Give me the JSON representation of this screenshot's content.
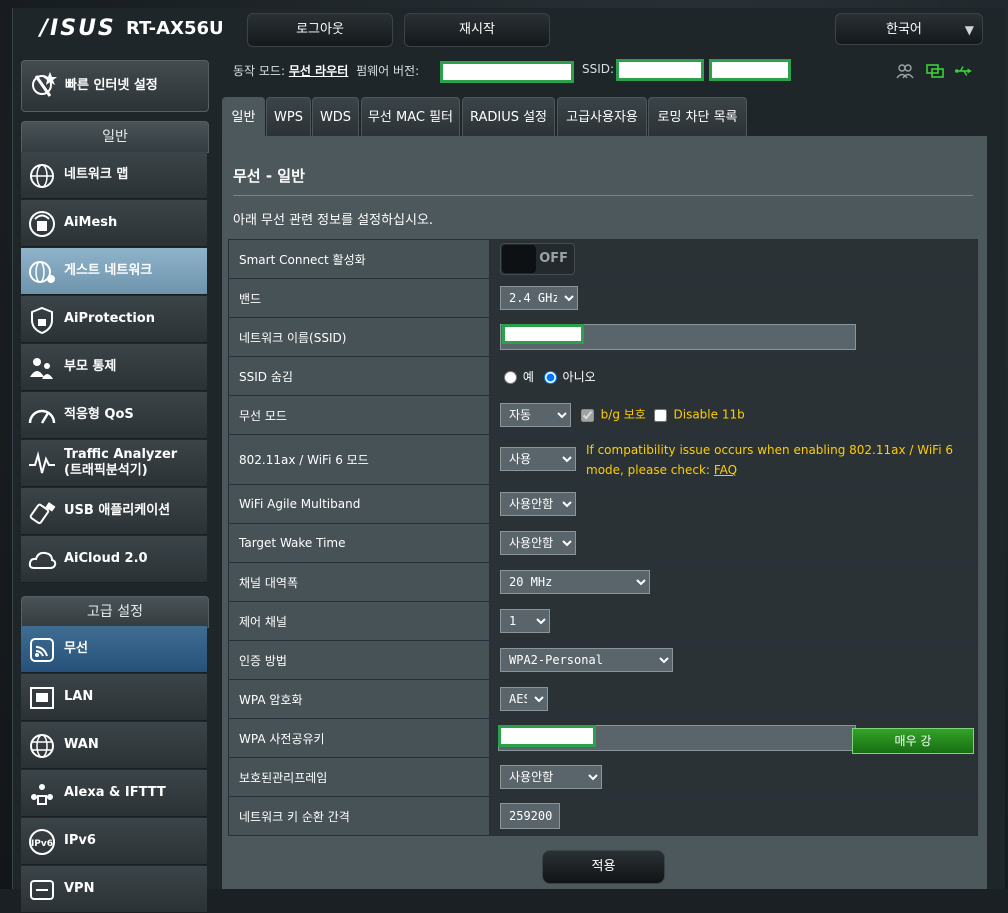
{
  "header": {
    "logo": "/ISUS",
    "model": "RT-AX56U",
    "logout_label": "로그아웃",
    "reboot_label": "재시작",
    "language": "한국어"
  },
  "sidebar": {
    "quick_setup": "빠른 인터넷 설정",
    "general_header": "일반",
    "general_items": [
      {
        "label": "네트워크 맵",
        "icon": "globe-network-icon"
      },
      {
        "label": "AiMesh",
        "icon": "aimesh-icon"
      },
      {
        "label": "게스트 네트워크",
        "icon": "guest-network-icon"
      },
      {
        "label": "AiProtection",
        "icon": "lock-shield-icon"
      },
      {
        "label": "부모 통제",
        "icon": "parental-control-icon"
      },
      {
        "label": "적응형 QoS",
        "icon": "speedometer-icon"
      },
      {
        "label": "Traffic Analyzer",
        "label2": "(트래픽분석기)",
        "icon": "traffic-analyzer-icon"
      },
      {
        "label": "USB 애플리케이션",
        "icon": "usb-icon"
      },
      {
        "label": "AiCloud 2.0",
        "icon": "cloud-icon"
      }
    ],
    "advanced_header": "고급 설정",
    "advanced_items": [
      {
        "label": "무선",
        "icon": "wireless-icon"
      },
      {
        "label": "LAN",
        "icon": "lan-icon"
      },
      {
        "label": "WAN",
        "icon": "wan-globe-icon"
      },
      {
        "label": "Alexa & IFTTT",
        "icon": "alexa-icon"
      },
      {
        "label": "IPv6",
        "icon": "ipv6-icon"
      },
      {
        "label": "VPN",
        "icon": "vpn-icon"
      }
    ]
  },
  "status": {
    "mode_label": "동작 모드:",
    "mode_value": "무선 라우터",
    "firmware_label": "펌웨어 버전:",
    "ssid_label": "SSID:"
  },
  "tabs": [
    "일반",
    "WPS",
    "WDS",
    "무선 MAC 필터",
    "RADIUS 설정",
    "고급사용자용",
    "로밍 차단 목록"
  ],
  "panel": {
    "title": "무선 - 일반",
    "description": "아래 무선 관련 정보를 설정하십시오."
  },
  "form": {
    "smart_connect_label": "Smart Connect 활성화",
    "smart_connect_state": "OFF",
    "band_label": "밴드",
    "band_value": "2.4 GHz",
    "ssid_label": "네트워크 이름(SSID)",
    "hide_ssid_label": "SSID 숨김",
    "hide_ssid_yes": "예",
    "hide_ssid_no": "아니오",
    "wireless_mode_label": "무선 모드",
    "wireless_mode_value": "자동",
    "bg_protection_label": "b/g 보호",
    "disable11b_label": "Disable 11b",
    "ax_mode_label": "802.11ax / WiFi 6 모드",
    "ax_mode_value": "사용",
    "ax_note": "If compatibility issue occurs when enabling 802.11ax / WiFi 6 mode, please check:",
    "ax_note_link": "FAQ",
    "agile_label": "WiFi Agile Multiband",
    "agile_value": "사용안함",
    "twt_label": "Target Wake Time",
    "twt_value": "사용안함",
    "bandwidth_label": "채널 대역폭",
    "bandwidth_value": "20 MHz",
    "channel_label": "제어 채널",
    "channel_value": "1",
    "auth_label": "인증 방법",
    "auth_value": "WPA2-Personal",
    "enc_label": "WPA 암호화",
    "enc_value": "AES",
    "psk_label": "WPA 사전공유키",
    "psk_strength": "매우 강",
    "pmf_label": "보호된관리프레임",
    "pmf_value": "사용안함",
    "rotation_label": "네트워크 키 순환 간격",
    "rotation_value": "259200"
  },
  "apply_label": "적용"
}
